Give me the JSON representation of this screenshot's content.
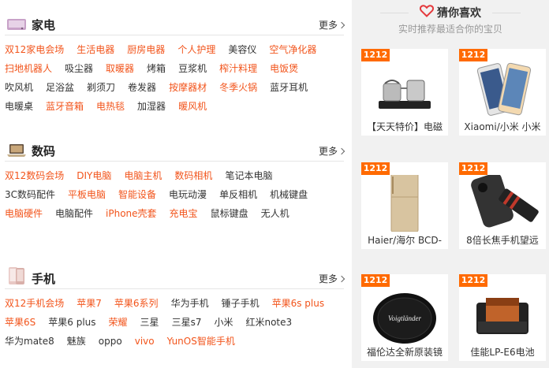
{
  "categories": [
    {
      "title": "家电",
      "icon": "appliance-icon",
      "more_label": "更多",
      "rows": [
        [
          {
            "t": "双12家电会场",
            "hot": true
          },
          {
            "t": "生活电器",
            "hot": true
          },
          {
            "t": "厨房电器",
            "hot": true
          },
          {
            "t": "个人护理",
            "hot": true
          },
          {
            "t": "美容仪",
            "hot": false
          },
          {
            "t": "空气净化器",
            "hot": true
          }
        ],
        [
          {
            "t": "扫地机器人",
            "hot": true
          },
          {
            "t": "吸尘器",
            "hot": false
          },
          {
            "t": "取暖器",
            "hot": true
          },
          {
            "t": "烤箱",
            "hot": false
          },
          {
            "t": "豆浆机",
            "hot": false
          },
          {
            "t": "榨汁料理",
            "hot": true
          },
          {
            "t": "电饭煲",
            "hot": true
          }
        ],
        [
          {
            "t": "吹风机",
            "hot": false
          },
          {
            "t": "足浴盆",
            "hot": false
          },
          {
            "t": "剃须刀",
            "hot": false
          },
          {
            "t": "卷发器",
            "hot": false
          },
          {
            "t": "按摩器材",
            "hot": true
          },
          {
            "t": "冬季火锅",
            "hot": true
          },
          {
            "t": "蓝牙耳机",
            "hot": false
          }
        ],
        [
          {
            "t": "电暖桌",
            "hot": false
          },
          {
            "t": "蓝牙音箱",
            "hot": true
          },
          {
            "t": "电热毯",
            "hot": true
          },
          {
            "t": "加湿器",
            "hot": false
          },
          {
            "t": "暖风机",
            "hot": true
          }
        ]
      ]
    },
    {
      "title": "数码",
      "icon": "laptop-icon",
      "more_label": "更多",
      "rows": [
        [
          {
            "t": "双12数码会场",
            "hot": true
          },
          {
            "t": "DIY电脑",
            "hot": true
          },
          {
            "t": "电脑主机",
            "hot": true
          },
          {
            "t": "数码相机",
            "hot": true
          },
          {
            "t": "笔记本电脑",
            "hot": false
          }
        ],
        [
          {
            "t": "3C数码配件",
            "hot": false
          },
          {
            "t": "平板电脑",
            "hot": true
          },
          {
            "t": "智能设备",
            "hot": true
          },
          {
            "t": "电玩动漫",
            "hot": false
          },
          {
            "t": "单反相机",
            "hot": false
          },
          {
            "t": "机械键盘",
            "hot": false
          }
        ],
        [
          {
            "t": "电脑硬件",
            "hot": true
          },
          {
            "t": "电脑配件",
            "hot": false
          },
          {
            "t": "iPhone壳套",
            "hot": true
          },
          {
            "t": "充电宝",
            "hot": true
          },
          {
            "t": "鼠标键盘",
            "hot": false
          },
          {
            "t": "无人机",
            "hot": false
          }
        ]
      ]
    },
    {
      "title": "手机",
      "icon": "phone-icon",
      "more_label": "更多",
      "rows": [
        [
          {
            "t": "双12手机会场",
            "hot": true
          },
          {
            "t": "苹果7",
            "hot": true
          },
          {
            "t": "苹果6系列",
            "hot": true
          },
          {
            "t": "华为手机",
            "hot": false
          },
          {
            "t": "锤子手机",
            "hot": false
          },
          {
            "t": "苹果6s plus",
            "hot": true
          }
        ],
        [
          {
            "t": "苹果6S",
            "hot": true
          },
          {
            "t": "苹果6 plus",
            "hot": false
          },
          {
            "t": "荣耀",
            "hot": true
          },
          {
            "t": "三星",
            "hot": false
          },
          {
            "t": "三星s7",
            "hot": false
          },
          {
            "t": "小米",
            "hot": false
          },
          {
            "t": "红米note3",
            "hot": false
          }
        ],
        [
          {
            "t": "华为mate8",
            "hot": false
          },
          {
            "t": "魅族",
            "hot": false
          },
          {
            "t": "oppo",
            "hot": false
          },
          {
            "t": "vivo",
            "hot": true
          },
          {
            "t": "YunOS智能手机",
            "hot": true
          }
        ]
      ]
    }
  ],
  "guess": {
    "title": "猜你喜欢",
    "subtitle": "实时推荐最适合你的宝贝",
    "tag": "1212",
    "products": [
      {
        "name": "【天天特价】电磁",
        "img": "kettle"
      },
      {
        "name": "Xiaomi/小米 小米",
        "img": "phone"
      },
      {
        "name": "Haier/海尔 BCD-",
        "img": "fridge"
      },
      {
        "name": "8倍长焦手机望远",
        "img": "lens"
      },
      {
        "name": "福伦达全新原装镜",
        "img": "cap"
      },
      {
        "name": "佳能LP-E6电池",
        "img": "battery"
      }
    ]
  },
  "brand_text": {
    "lens_cap": "Voigtländer"
  },
  "colors": {
    "hot": "#f2541b",
    "tag": "#ff6a00",
    "heart": "#e4393c",
    "sidebar_bg": "#f1f1f1"
  }
}
